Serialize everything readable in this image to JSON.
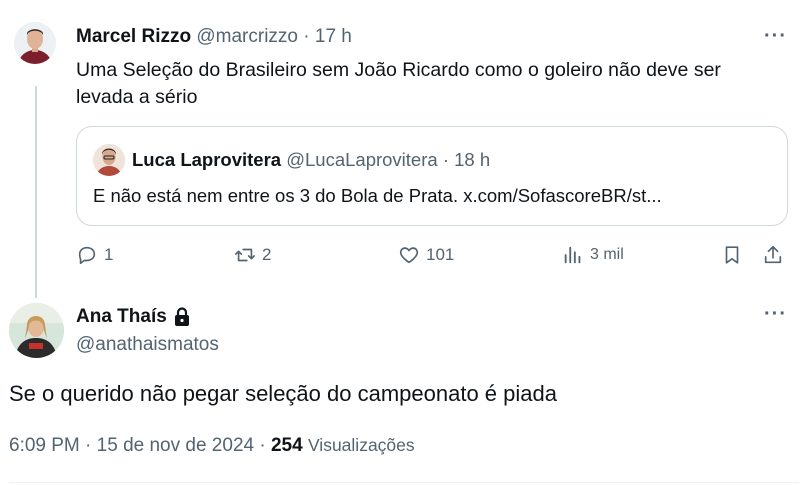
{
  "parent_tweet": {
    "author_name": "Marcel Rizzo",
    "handle": "@marcrizzo",
    "separator": "·",
    "time": "17 h",
    "text": "Uma Seleção do Brasileiro sem João Ricardo como o goleiro não deve ser levada a sério",
    "more_label": "···",
    "quoted": {
      "author_name": "Luca Laprovitera",
      "handle": "@LucaLaprovitera",
      "separator": "·",
      "time": "18 h",
      "text": "E não está nem entre os 3 do Bola de Prata. x.com/SofascoreBR/st..."
    },
    "actions": {
      "replies": "1",
      "reposts": "2",
      "likes": "101",
      "views": "3 mil"
    }
  },
  "main_tweet": {
    "author_name": "Ana Thaís",
    "handle": "@anathaismatos",
    "more_label": "···",
    "text": "Se o querido não pegar seleção do campeonato é piada",
    "time": "6:09 PM",
    "dot1": "·",
    "date": "15 de nov de 2024",
    "dot2": "·",
    "views_count": "254",
    "views_label": "Visualizações"
  },
  "icons": {
    "reply": "reply-icon",
    "repost": "repost-icon",
    "like": "heart-icon",
    "views": "views-chart-icon",
    "bookmark": "bookmark-icon",
    "share": "share-icon",
    "lock": "lock-icon"
  }
}
